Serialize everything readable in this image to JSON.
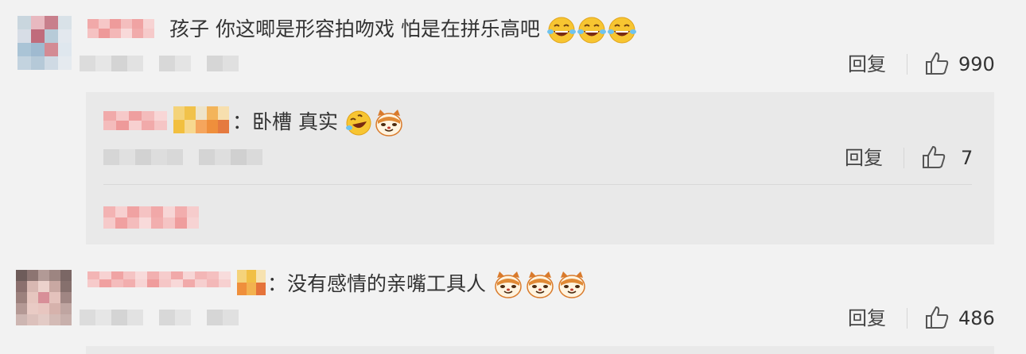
{
  "comments": [
    {
      "text": "孩子 你这唧是形容拍吻戏 怕是在拼乐高吧",
      "emojis": [
        "laugh-cry-emoji",
        "laugh-cry-emoji",
        "laugh-cry-emoji"
      ],
      "reply_label": "回复",
      "like_count": "990"
    },
    {
      "text": "：没有感情的亲嘴工具人",
      "emojis": [
        "doge-cat-emoji",
        "doge-cat-emoji",
        "doge-cat-emoji"
      ],
      "reply_label": "回复",
      "like_count": "486"
    }
  ],
  "reply": {
    "text": "：卧槽  真实",
    "emojis": [
      "laugh-roll-emoji",
      "doge-cat-emoji"
    ],
    "reply_label": "回复",
    "like_count": "7"
  },
  "colors": {
    "background": "#f2f2f2",
    "reply_box": "#e9e9e9",
    "emoji_yellow": "#f7c531",
    "blur_pink": "#f08c8c"
  }
}
